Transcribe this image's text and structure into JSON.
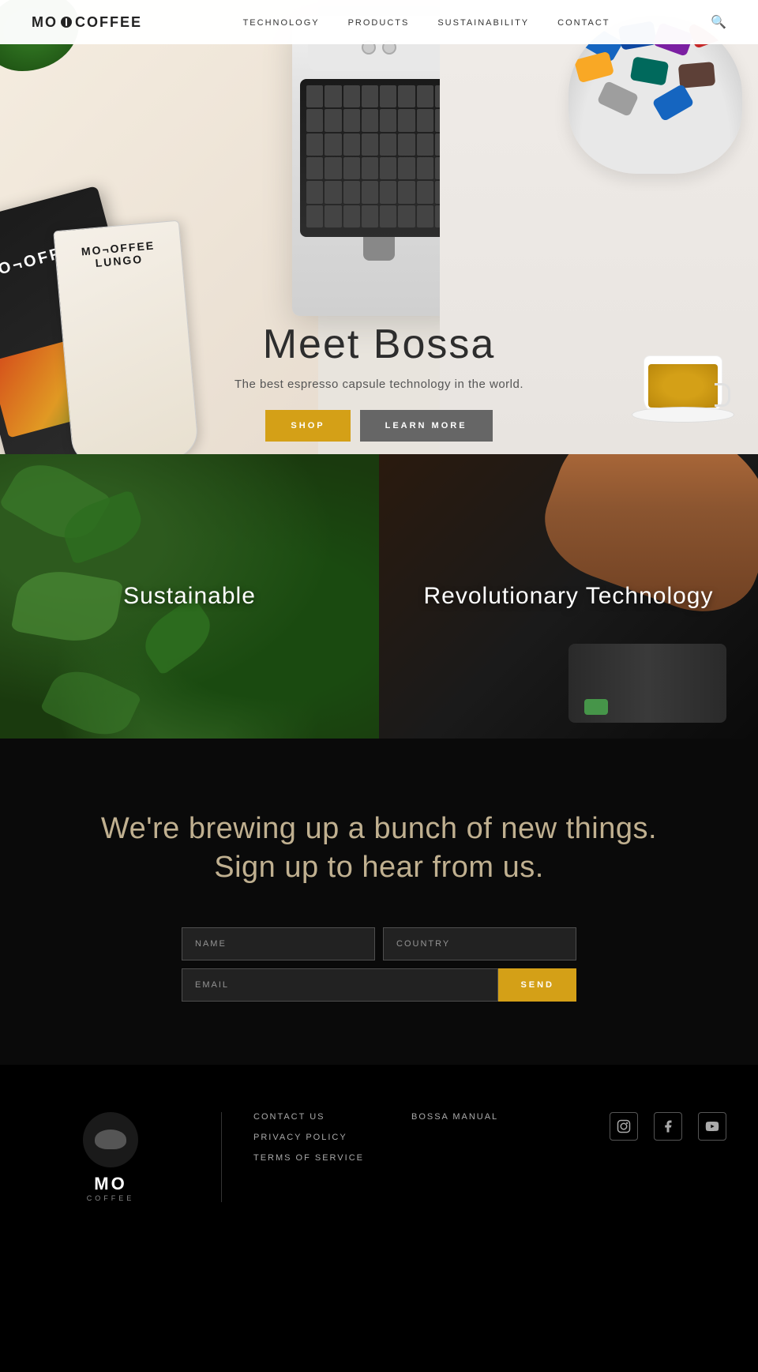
{
  "navbar": {
    "logo_mo": "MO",
    "logo_coffee": "COFFEE",
    "links": [
      {
        "label": "TECHNOLOGY",
        "href": "#"
      },
      {
        "label": "PRODUCTS",
        "href": "#"
      },
      {
        "label": "SUSTAINABILITY",
        "href": "#"
      },
      {
        "label": "CONTACT",
        "href": "#"
      }
    ]
  },
  "hero": {
    "title": "Meet Bossa",
    "subtitle": "The best espresso capsule technology in the world.",
    "shop_label": "SHOP",
    "learn_label": "LEARN MORE"
  },
  "panels": [
    {
      "label": "Sustainable"
    },
    {
      "label": "Revolutionary Technology"
    }
  ],
  "signup": {
    "heading_line1": "We're brewing up a bunch of new things.",
    "heading_line2": "Sign up to hear from us.",
    "name_placeholder": "NAME",
    "country_placeholder": "COUNTRY",
    "email_placeholder": "EMAIL",
    "send_label": "SEND"
  },
  "footer": {
    "logo_text": "MO",
    "logo_sub": "COFFEE",
    "links": [
      {
        "label": "CONTACT US"
      },
      {
        "label": "PRIVACY POLICY"
      },
      {
        "label": "TERMS OF SERVICE"
      }
    ],
    "bossa_manual": "BOSSA MANUAL",
    "social": [
      {
        "name": "instagram-icon",
        "symbol": "📷"
      },
      {
        "name": "facebook-icon",
        "symbol": "f"
      },
      {
        "name": "youtube-icon",
        "symbol": "▶"
      }
    ]
  },
  "colors": {
    "accent_gold": "#d4a017",
    "btn_gray": "#666666",
    "text_dark": "#2d2d2d",
    "text_muted": "#555555",
    "footer_text": "#aaaaaa"
  }
}
